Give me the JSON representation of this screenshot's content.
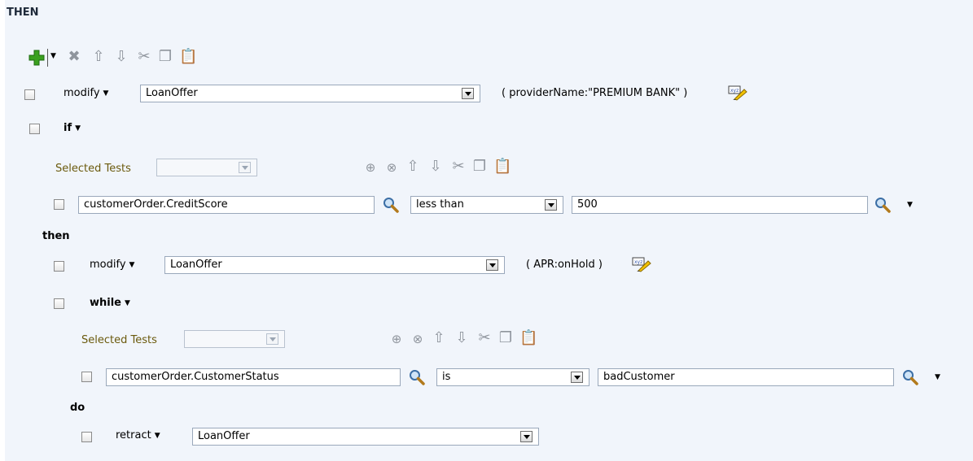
{
  "section": {
    "title": "THEN"
  },
  "toolbar": {
    "icons": [
      "add-icon",
      "chevron-down-icon",
      "delete-icon",
      "move-up-icon",
      "move-down-icon",
      "cut-icon",
      "copy-icon",
      "paste-icon"
    ]
  },
  "action1": {
    "keyword": "modify",
    "fact": "LoanOffer",
    "params": "( providerName:\"PREMIUM BANK\" )"
  },
  "if_block": {
    "keyword": "if",
    "selected_tests_label": "Selected Tests",
    "selected_tests_value": "",
    "test": {
      "left": "customerOrder.CreditScore",
      "operator": "less than",
      "right": "500"
    },
    "then_label": "then",
    "then_action": {
      "keyword": "modify",
      "fact": "LoanOffer",
      "params": "( APR:onHold )"
    }
  },
  "while_block": {
    "keyword": "while",
    "selected_tests_label": "Selected Tests",
    "selected_tests_value": "",
    "test": {
      "left": "customerOrder.CustomerStatus",
      "operator": "is",
      "right": "badCustomer"
    },
    "do_label": "do",
    "do_action": {
      "keyword": "retract",
      "fact": "LoanOffer"
    }
  },
  "colors": {
    "panel_bg": "#f1f5fb",
    "add_green": "#3aa01f",
    "label_gold": "#6b5a0d"
  }
}
